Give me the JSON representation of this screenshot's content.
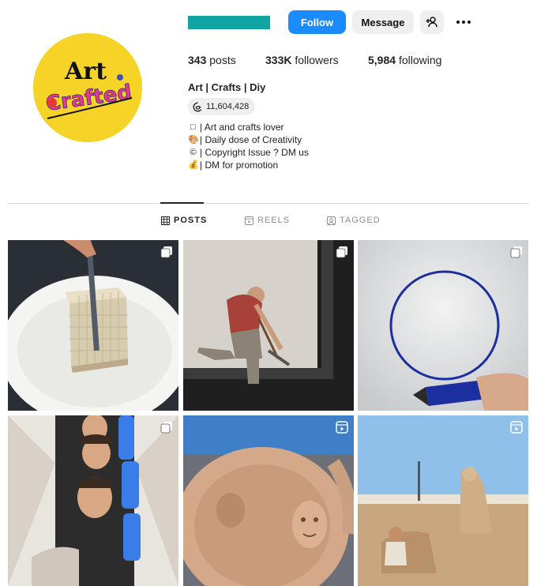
{
  "profile": {
    "avatar_text_top": "Art",
    "avatar_text_bottom": "Crafted"
  },
  "actions": {
    "follow": "Follow",
    "message": "Message"
  },
  "stats": {
    "posts_count": "343",
    "posts_label": "posts",
    "followers_count": "333K",
    "followers_label": "followers",
    "following_count": "5,984",
    "following_label": "following"
  },
  "bio": {
    "name": "Art | Crafts | Diy",
    "threads_count": "11,604,428",
    "lines": [
      {
        "icon": "□",
        "text": "| Art and crafts lover"
      },
      {
        "icon": "🎨",
        "text": "| Daily dose of Creativity"
      },
      {
        "icon": "©",
        "text": "| Copyright Issue ? DM us"
      },
      {
        "icon": "💰",
        "text": "| DM for promotion"
      }
    ]
  },
  "tabs": {
    "posts": "POSTS",
    "reels": "REELS",
    "tagged": "TAGGED"
  },
  "colors": {
    "accent": "#1a8cff",
    "avatar_bg": "#f5d327",
    "username_redaction": "#12a3a3"
  },
  "grid": {
    "tiles": [
      {
        "scene": "knife-cutting-tofu-block",
        "badge": "carousel-icon"
      },
      {
        "scene": "man-with-pickaxe-painting-frame",
        "badge": "carousel-icon"
      },
      {
        "scene": "blue-circle-marker-drawing",
        "badge": "carousel-icon"
      },
      {
        "scene": "faces-and-blue-gloves-illusion",
        "badge": "carousel-icon"
      },
      {
        "scene": "ceramic-plate-with-face",
        "badge": "reel-icon"
      },
      {
        "scene": "sand-sculpture-beach",
        "badge": "reel-icon"
      }
    ]
  }
}
